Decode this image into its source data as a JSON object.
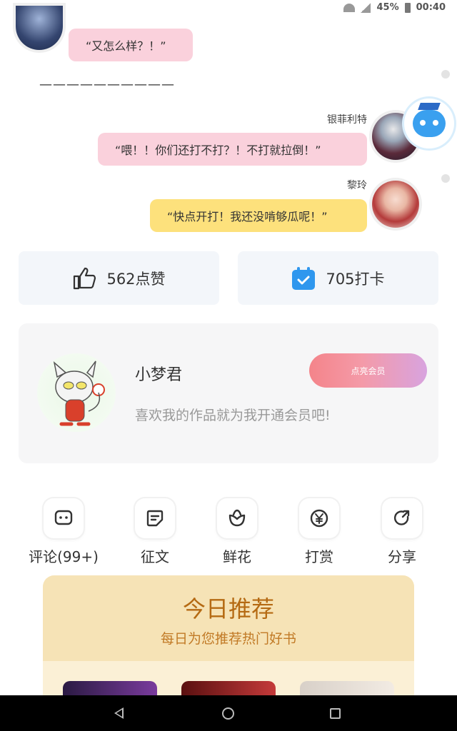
{
  "status_bar": {
    "battery": "45%",
    "time": "00:40"
  },
  "chat": {
    "message_1": "“又怎么样？！”",
    "divider": "——————————",
    "sender_2": "银菲利特",
    "message_2": "“喂！！你们还打不打？！不打就拉倒！”",
    "sender_3": "黎玲",
    "message_3": "“快点开打！我还没啃够瓜呢！”"
  },
  "stats": {
    "likes": "562点赞",
    "checkins": "705打卡"
  },
  "member": {
    "name": "小梦君",
    "description": "喜欢我的作品就为我开通会员吧!",
    "button": "点亮会员"
  },
  "actions": [
    {
      "label": "评论(99+)",
      "icon": "comment-icon"
    },
    {
      "label": "征文",
      "icon": "essay-icon"
    },
    {
      "label": "鲜花",
      "icon": "flower-icon"
    },
    {
      "label": "打赏",
      "icon": "yuan-icon"
    },
    {
      "label": "分享",
      "icon": "share-icon"
    }
  ],
  "recommend": {
    "title": "今日推荐",
    "subtitle": "每日为您推荐热门好书"
  },
  "colors": {
    "pink_bubble": "#fad1dc",
    "yellow_bubble": "#fde17c",
    "checkin_blue": "#2f97ee",
    "recommend_title": "#b56a13"
  }
}
